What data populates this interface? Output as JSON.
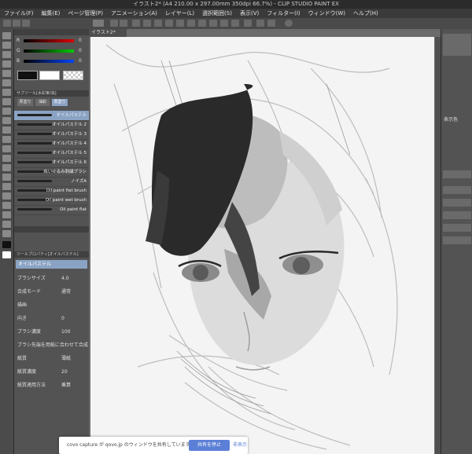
{
  "window": {
    "title": "イラスト2* (A4 210.00 x 297.00mm 350dpi 66.7%) - CLIP STUDIO PAINT EX"
  },
  "menu": [
    "ファイル(F)",
    "編集(E)",
    "ページ管理(P)",
    "アニメーション(A)",
    "レイヤー(L)",
    "選択範囲(S)",
    "表示(V)",
    "フィルター(I)",
    "ウィンドウ(W)",
    "ヘルプ(H)"
  ],
  "canvas_tab": "イラスト2*",
  "color_slider": {
    "r": "0",
    "g": "0",
    "b": "0",
    "labels": [
      "R",
      "G",
      "B"
    ]
  },
  "subtool_header": "サブツール[水彩筆/油]",
  "subtool_tabs": [
    "厚塗り",
    "油彩",
    "厚塗り"
  ],
  "brushes": [
    "オイルパステル",
    "オイルパステル 2",
    "オイルパステル 3",
    "オイルパステル 4",
    "オイルパステル 5",
    "オイルパステル 6",
    "ぬいぐるみ刺繍ブラシ",
    "ノイズA",
    "Oil paint flat brush",
    "Oil paint wet brush",
    "Oil paint flat"
  ],
  "toolprop_header": "ツールプロパティ[オイルパステル]",
  "toolprop_title": "オイルパステル",
  "props": [
    {
      "label": "ブラシサイズ",
      "value": "4.0"
    },
    {
      "label": "合成モード",
      "value": "通常"
    },
    {
      "label": "描画",
      "value": ""
    },
    {
      "label": "向き",
      "value": "0"
    },
    {
      "label": "ブラシ濃度",
      "value": "100"
    },
    {
      "label": "ブラシ先端を用紙に合わせて合成",
      "value": ""
    },
    {
      "label": "紙質",
      "value": "薄紙"
    },
    {
      "label": "紙質濃度",
      "value": "20"
    },
    {
      "label": "紙質適用方法",
      "value": "乗算"
    }
  ],
  "right_panel": {
    "label1": "表示色"
  },
  "share": {
    "text": "covo capture が qovo.jp のウィンドウを共有しています。",
    "stop": "共有を停止",
    "hide": "非表示"
  }
}
